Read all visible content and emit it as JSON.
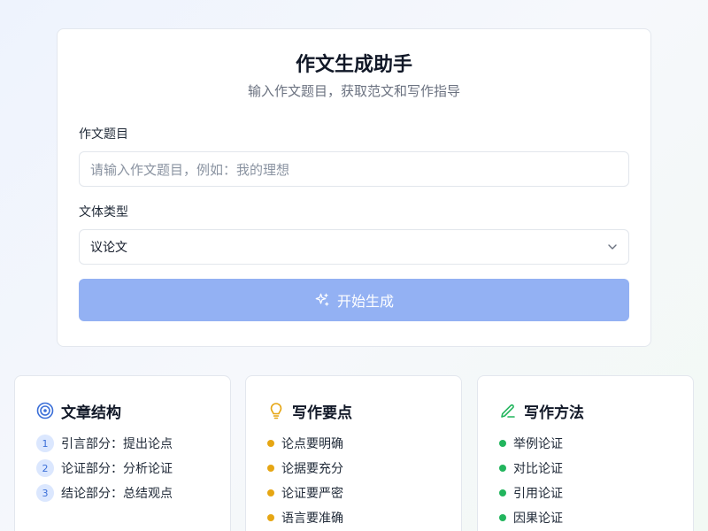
{
  "header": {
    "title": "作文生成助手",
    "subtitle": "输入作文题目，获取范文和写作指导"
  },
  "form": {
    "topic_label": "作文题目",
    "topic_placeholder": "请输入作文题目，例如：我的理想",
    "type_label": "文体类型",
    "type_value": "议论文",
    "submit_label": "开始生成"
  },
  "cards": {
    "structure": {
      "title": "文章结构",
      "icon": "target-icon",
      "items": [
        {
          "num": "1",
          "text": "引言部分：提出论点"
        },
        {
          "num": "2",
          "text": "论证部分：分析论证"
        },
        {
          "num": "3",
          "text": "结论部分：总结观点"
        }
      ]
    },
    "key_points": {
      "title": "写作要点",
      "icon": "lightbulb-icon",
      "items": [
        "论点要明确",
        "论据要充分",
        "论证要严密",
        "语言要准确"
      ]
    },
    "methods": {
      "title": "写作方法",
      "icon": "pencil-icon",
      "items": [
        "举例论证",
        "对比论证",
        "引用论证",
        "因果论证"
      ]
    }
  },
  "colors": {
    "primary_button": "#93b1f3",
    "accent_blue": "#3b6fd8",
    "accent_amber": "#e6a613",
    "accent_green": "#22b55d"
  }
}
